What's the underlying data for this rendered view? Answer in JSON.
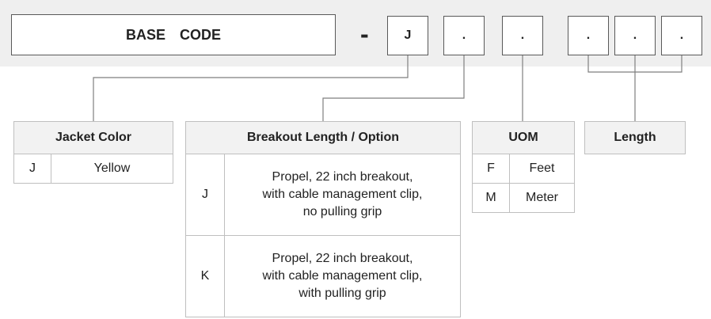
{
  "code": {
    "base_label": "BASE  CODE",
    "separator": "-",
    "segments": [
      "J",
      ".",
      ".",
      ".",
      ".",
      "."
    ]
  },
  "tables": {
    "jacket": {
      "header": "Jacket Color",
      "rows": [
        {
          "code": "J",
          "label": "Yellow"
        }
      ]
    },
    "breakout": {
      "header": "Breakout Length / Option",
      "rows": [
        {
          "code": "J",
          "label": "Propel, 22 inch breakout,\nwith cable management clip,\nno pulling grip"
        },
        {
          "code": "K",
          "label": "Propel, 22 inch breakout,\nwith cable management clip,\nwith pulling grip"
        }
      ]
    },
    "uom": {
      "header": "UOM",
      "rows": [
        {
          "code": "F",
          "label": "Feet"
        },
        {
          "code": "M",
          "label": "Meter"
        }
      ]
    },
    "length": {
      "header": "Length"
    }
  },
  "colors": {
    "bar_background": "#efefef",
    "box_border": "#595959",
    "table_border": "#bfbfbf",
    "header_fill": "#f2f2f2"
  }
}
